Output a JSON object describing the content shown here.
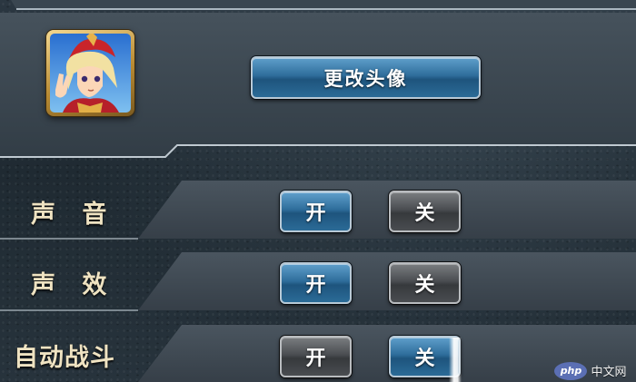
{
  "profile": {
    "change_avatar_label": "更改头像"
  },
  "settings": {
    "sound": {
      "label": "声 音",
      "on_label": "开",
      "off_label": "关",
      "selected": "on"
    },
    "sound_effects": {
      "label": "声 效",
      "on_label": "开",
      "off_label": "关",
      "selected": "on"
    },
    "auto_battle": {
      "label": "自动战斗",
      "on_label": "开",
      "off_label": "关",
      "selected": "off"
    }
  },
  "watermark": {
    "logo": "php",
    "text": "中文网"
  },
  "colors": {
    "selected_button": "#2e6d9b",
    "unselected_button": "#4a4d51",
    "label_text": "#efe3c2",
    "panel": "#3a4650"
  }
}
